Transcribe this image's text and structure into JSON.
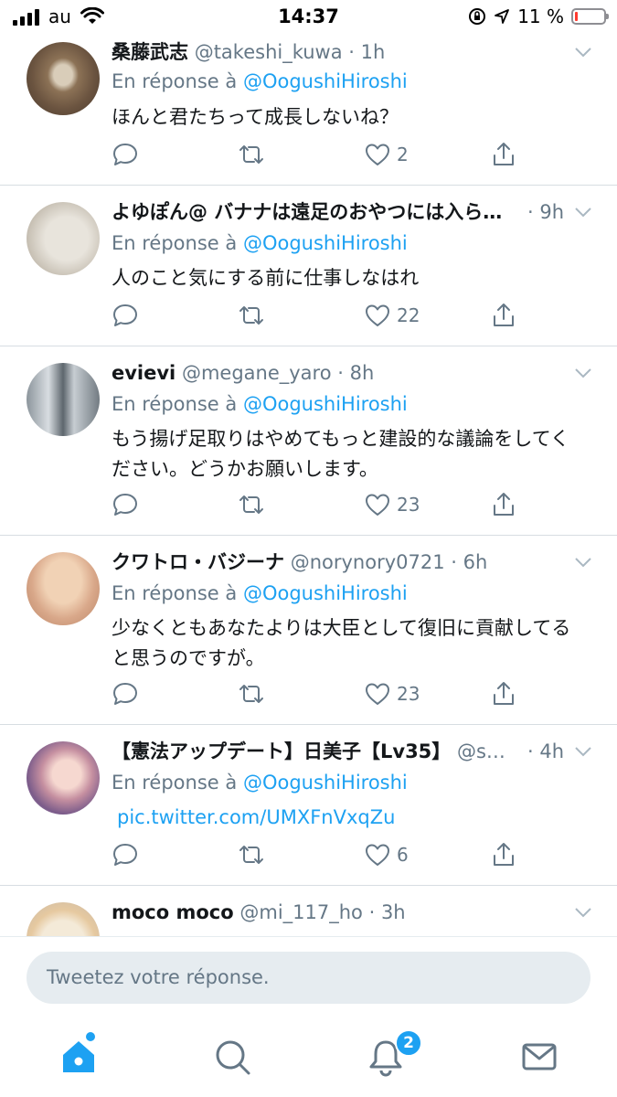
{
  "status_bar": {
    "carrier": "au",
    "time": "14:37",
    "battery_percent": "11 %",
    "battery_level": 0.11
  },
  "tweets": [
    {
      "name": "桑藤武志",
      "handle": "@takeshi_kuwa",
      "time": "· 1h",
      "reply_prefix": "En réponse à",
      "reply_to": "@OogushiHiroshi",
      "text": "ほんと君たちって成長しないね？",
      "likes": "2"
    },
    {
      "name": "よゆぽん@ バナナは遠足のおやつには入ら…",
      "handle": "",
      "time": "· 9h",
      "reply_prefix": "En réponse à",
      "reply_to": "@OogushiHiroshi",
      "text": "人のこと気にする前に仕事しなはれ",
      "likes": "22"
    },
    {
      "name": "evievi",
      "handle": "@megane_yaro",
      "time": "· 8h",
      "reply_prefix": "En réponse à",
      "reply_to": "@OogushiHiroshi",
      "text": "もう揚げ足取りはやめてもっと建設的な議論をしてください。どうかお願いします。",
      "likes": "23"
    },
    {
      "name": "クワトロ・バジーナ",
      "handle": "@norynory0721",
      "time": "· 6h",
      "reply_prefix": "En réponse à",
      "reply_to": "@OogushiHiroshi",
      "text": "少なくともあなたよりは大臣として復旧に貢献してると思うのですが。",
      "likes": "23"
    },
    {
      "name": "【憲法アップデート】日美子【Lv35】",
      "handle": "@s…",
      "time": "· 4h",
      "reply_prefix": "En réponse à",
      "reply_to": "@OogushiHiroshi",
      "text": "pic.twitter.com/UMXFnVxqZu",
      "likes": "6"
    },
    {
      "name": "moco moco",
      "handle": "@mi_117_ho",
      "time": "· 3h",
      "reply_prefix": "",
      "reply_to": "",
      "text": "",
      "likes": ""
    }
  ],
  "composer": {
    "placeholder": "Tweetez votre réponse."
  },
  "tabbar": {
    "notifications_badge": "2",
    "icons": [
      "home-icon",
      "search-icon",
      "bell-icon",
      "mail-icon"
    ]
  },
  "colors": {
    "accent": "#1da1f2",
    "secondary_text": "#657786",
    "divider": "#d7dde2",
    "battery_low": "#ff3b30"
  }
}
